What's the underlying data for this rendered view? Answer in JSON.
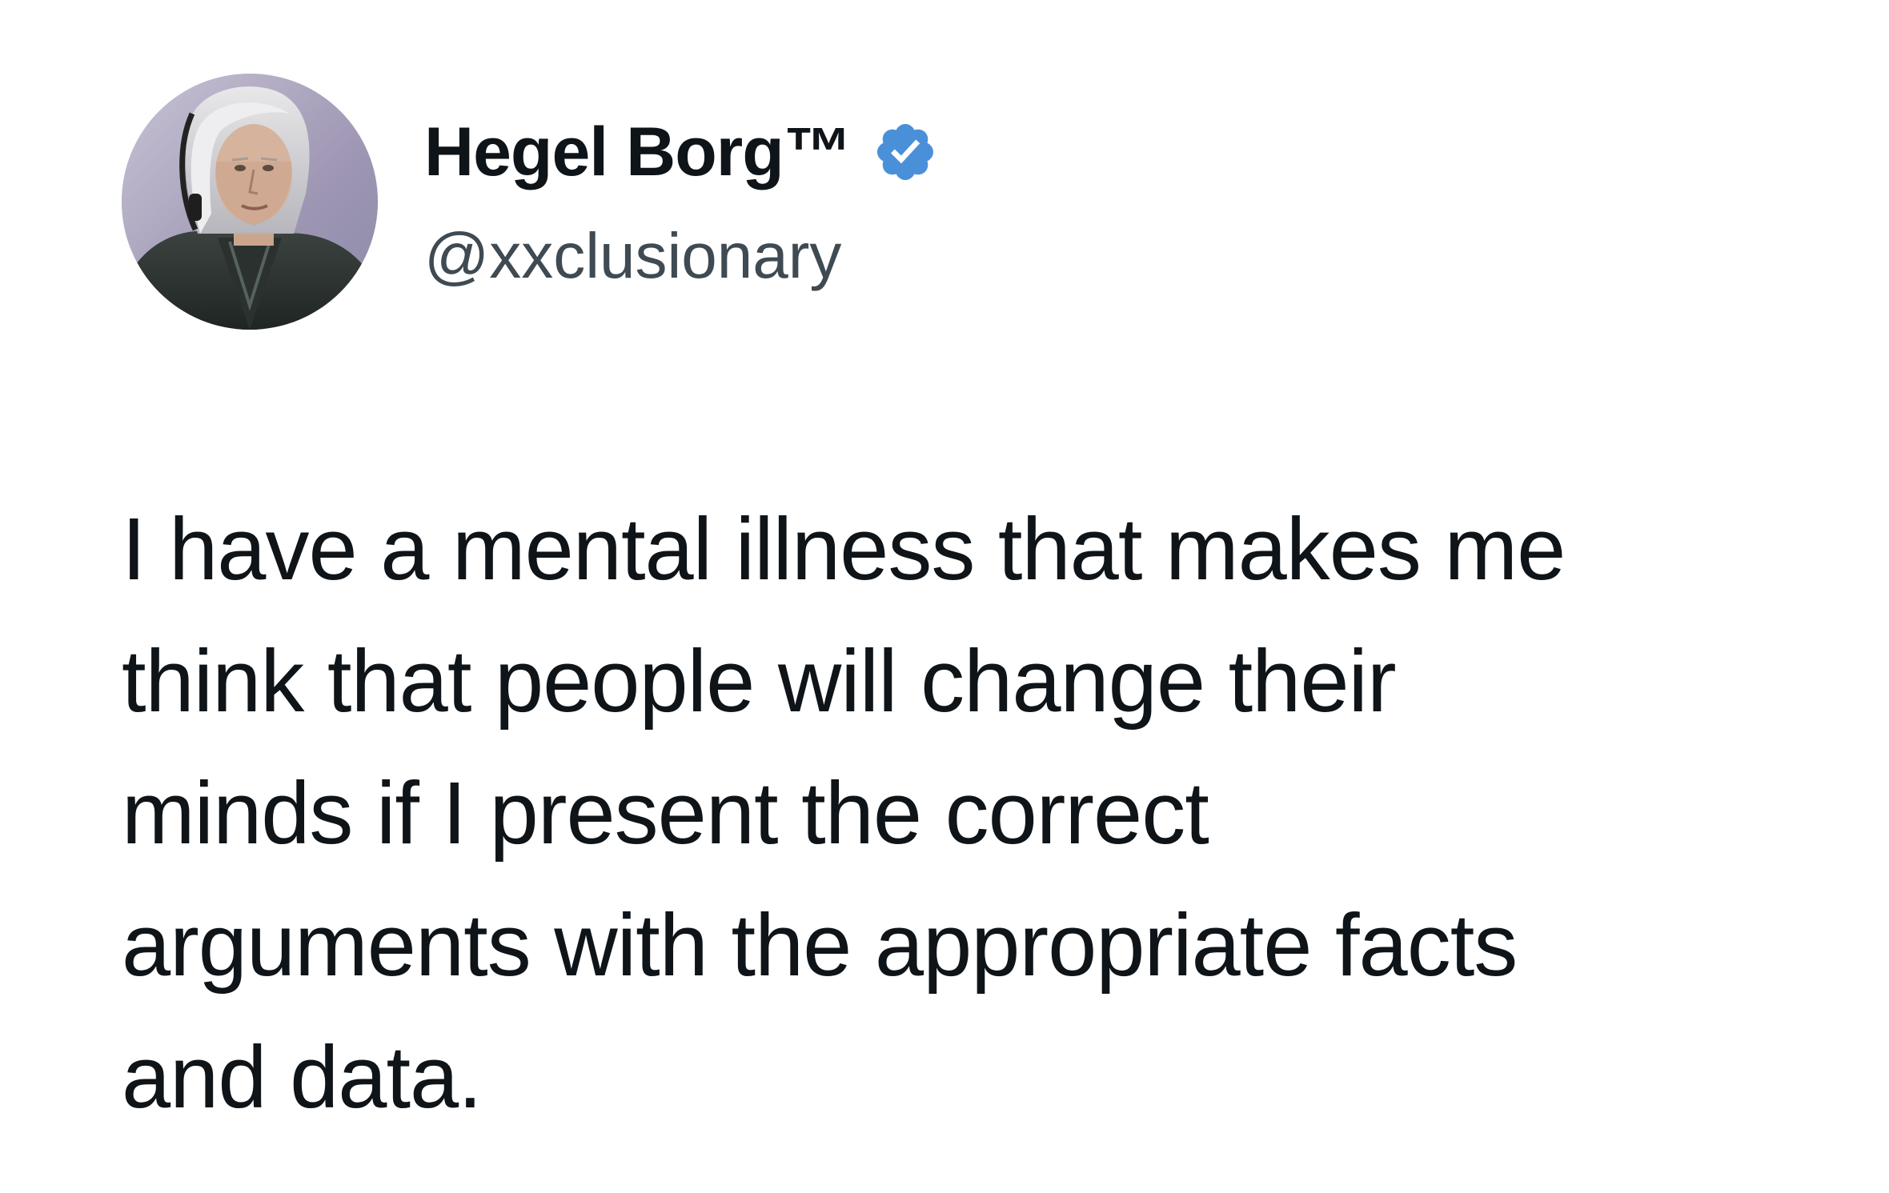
{
  "tweet": {
    "author": {
      "display_name": "Hegel Borg™",
      "handle": "@xxclusionary",
      "verified_icon": "verified-badge-icon",
      "avatar": "profile-photo"
    },
    "text_lines": [
      "I have a mental illness that makes me",
      "think that people will change their",
      "minds if I present the correct",
      "arguments with the appropriate facts",
      "and data."
    ]
  },
  "colors": {
    "verified_blue": "#4a90d9",
    "text": "#0f1419",
    "handle": "#3f4a52",
    "background": "#ffffff"
  }
}
